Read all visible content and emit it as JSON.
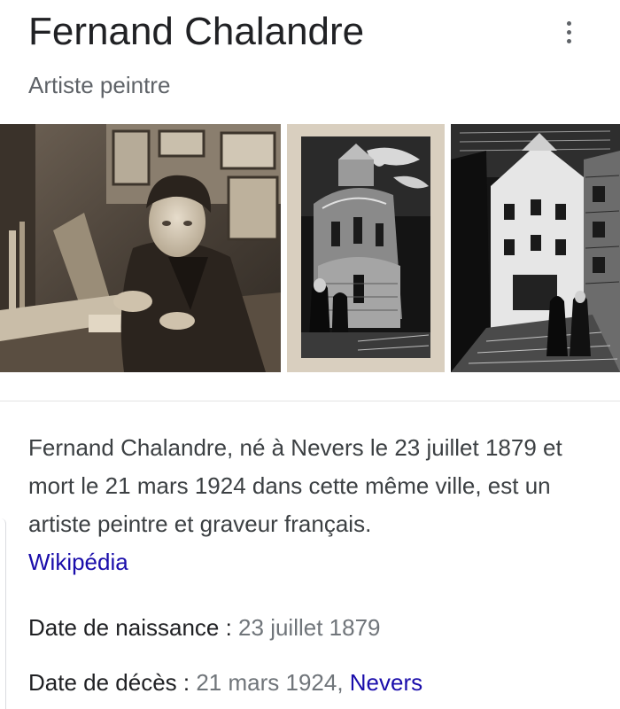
{
  "header": {
    "title": "Fernand Chalandre",
    "subtitle": "Artiste peintre",
    "more_icon": "more-vertical-icon"
  },
  "images": [
    {
      "name": "portrait-photo",
      "kind": "sepia photograph of the artist at his desk"
    },
    {
      "name": "church-engraving",
      "kind": "woodcut of a Romanesque church apse"
    },
    {
      "name": "street-engraving",
      "kind": "woodcut of an old town street"
    }
  ],
  "description": {
    "text": "Fernand Chalandre, né à Nevers le 23 juillet 1879 et mort le 21 mars 1924 dans cette même ville, est un artiste peintre et graveur français.",
    "source_link": "Wikipédia"
  },
  "facts": {
    "birth": {
      "label": "Date de naissance",
      "separator": " : ",
      "value": "23 juillet 1879"
    },
    "death": {
      "label": "Date de décès",
      "separator": " : ",
      "value": "21 mars 1924, ",
      "place_link": "Nevers"
    }
  },
  "colors": {
    "title": "#202124",
    "subtitle": "#5f6368",
    "link": "#1a0dab",
    "value_gray": "#70757a"
  }
}
